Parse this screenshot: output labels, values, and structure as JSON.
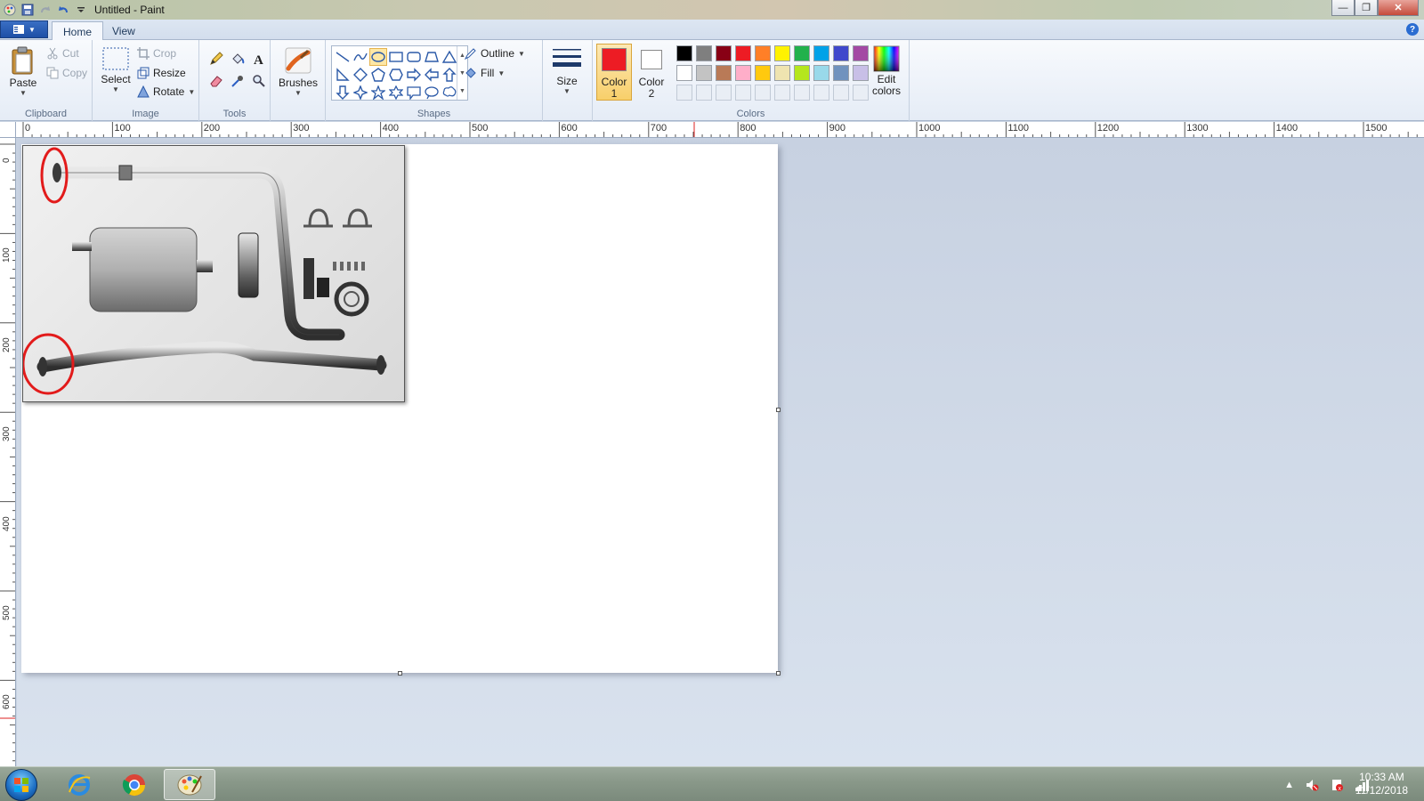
{
  "window": {
    "title": "Untitled - Paint"
  },
  "tabs": [
    {
      "label": "Home",
      "active": true
    },
    {
      "label": "View",
      "active": false
    }
  ],
  "ribbon": {
    "clipboard": {
      "label": "Clipboard",
      "paste": "Paste",
      "cut": "Cut",
      "copy": "Copy"
    },
    "image": {
      "label": "Image",
      "select": "Select",
      "crop": "Crop",
      "resize": "Resize",
      "rotate": "Rotate"
    },
    "tools": {
      "label": "Tools",
      "tool_icons": [
        "pencil-icon",
        "fill-icon",
        "text-icon",
        "eraser-icon",
        "color-picker-icon",
        "magnifier-icon"
      ]
    },
    "brushes": {
      "label": "Brushes"
    },
    "shapes": {
      "label": "Shapes",
      "outline": "Outline",
      "fill": "Fill"
    },
    "size": {
      "label": "Size"
    },
    "colors": {
      "label": "Colors",
      "color1": {
        "line1": "Color",
        "line2": "1",
        "value": "#ed1c24"
      },
      "color2": {
        "line1": "Color",
        "line2": "2",
        "value": "#ffffff"
      },
      "edit_line1": "Edit",
      "edit_line2": "colors",
      "palette_row1": [
        "#000000",
        "#7f7f7f",
        "#880015",
        "#ed1c24",
        "#ff7f27",
        "#fff200",
        "#22b14c",
        "#00a2e8",
        "#3f48cc",
        "#a349a4"
      ],
      "palette_row2": [
        "#ffffff",
        "#c3c3c3",
        "#b97a57",
        "#ffaec9",
        "#ffc90e",
        "#efe4b0",
        "#b5e61d",
        "#99d9ea",
        "#7092be",
        "#c8bfe7"
      ]
    }
  },
  "ruler": {
    "horizontal": [
      "0",
      "100",
      "200",
      "300",
      "400",
      "500",
      "600",
      "700",
      "800",
      "900",
      "1000",
      "1100",
      "1200",
      "1300",
      "1400",
      "1500"
    ],
    "vertical": [
      "0",
      "100",
      "200",
      "300",
      "400",
      "500",
      "600"
    ]
  },
  "taskbar": {
    "time": "10:33 AM",
    "date": "11/12/2018"
  }
}
